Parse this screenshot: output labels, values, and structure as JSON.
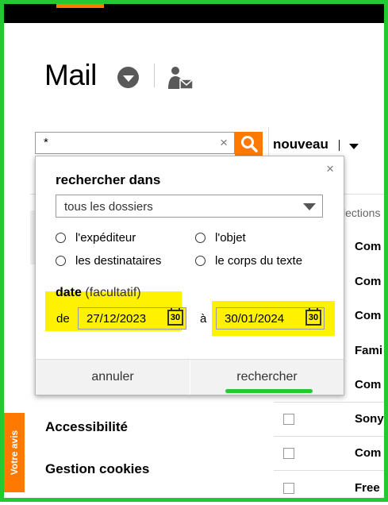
{
  "page": {
    "title": "Mail"
  },
  "search": {
    "value": "*",
    "clear": "×"
  },
  "toolbar": {
    "new_label": "nouveau"
  },
  "background": {
    "selection_label": "lections",
    "rows": [
      "Com",
      "Com",
      "Com",
      "Fami",
      "Com",
      "Sony",
      "Com",
      "Free"
    ]
  },
  "footer": {
    "accessibility": "Accessibilité",
    "cookies": "Gestion cookies",
    "feedback": "Votre avis"
  },
  "popup": {
    "close": "×",
    "heading": "rechercher dans",
    "folder_select": "tous les dossiers",
    "options": {
      "sender": "l'expéditeur",
      "subject": "l'objet",
      "recipients": "les destinataires",
      "body": "le corps du texte"
    },
    "date_label": "date",
    "date_optional": "(facultatif)",
    "from_label": "de",
    "from_value": "27/12/2023",
    "to_label": "à",
    "to_value": "30/01/2024",
    "calendar_day": "30",
    "cancel": "annuler",
    "search": "rechercher"
  },
  "colors": {
    "accent": "#ff7900",
    "highlight": "#fff200",
    "frame": "#22c932"
  }
}
